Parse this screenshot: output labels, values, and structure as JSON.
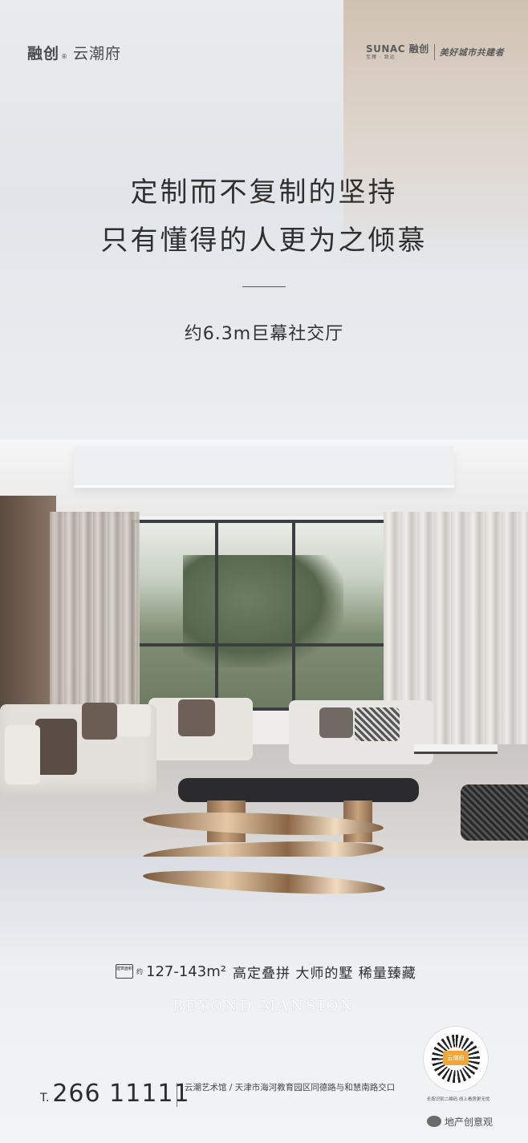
{
  "brand": {
    "left_logo": "融创",
    "left_registered": "®",
    "left_project": "云潮府",
    "right_logo": "SUNAC 融创",
    "right_logo_sub": "至臻 · 致远",
    "right_slogan": "美好城市共建者"
  },
  "headline": {
    "line1": "定制而不复制的坚持",
    "line2": "只有懂得的人更为之倾慕"
  },
  "subhead": "约6.3m巨幕社交厅",
  "area": {
    "tag": "建筑面积",
    "prefix": "约",
    "range": "127-143m²",
    "tagline": "高定叠拼 大师的墅 稀量臻藏"
  },
  "english_tagline": "BEYOND MANSION",
  "contact": {
    "phone_prefix": "T.",
    "phone": "266 11111",
    "address": "云潮艺术馆 / 天津市海河教育园区同德路与和慧南路交口"
  },
  "qr": {
    "label": "云潮府",
    "caption": "长按识别二维码 线上看房更无忧"
  },
  "watermark": {
    "text": "地产创意观",
    "icon": "wechat-icon"
  },
  "colors": {
    "background": "#eef0f3",
    "text": "#2f2f2f",
    "accent_gold": "#c7a27c"
  }
}
